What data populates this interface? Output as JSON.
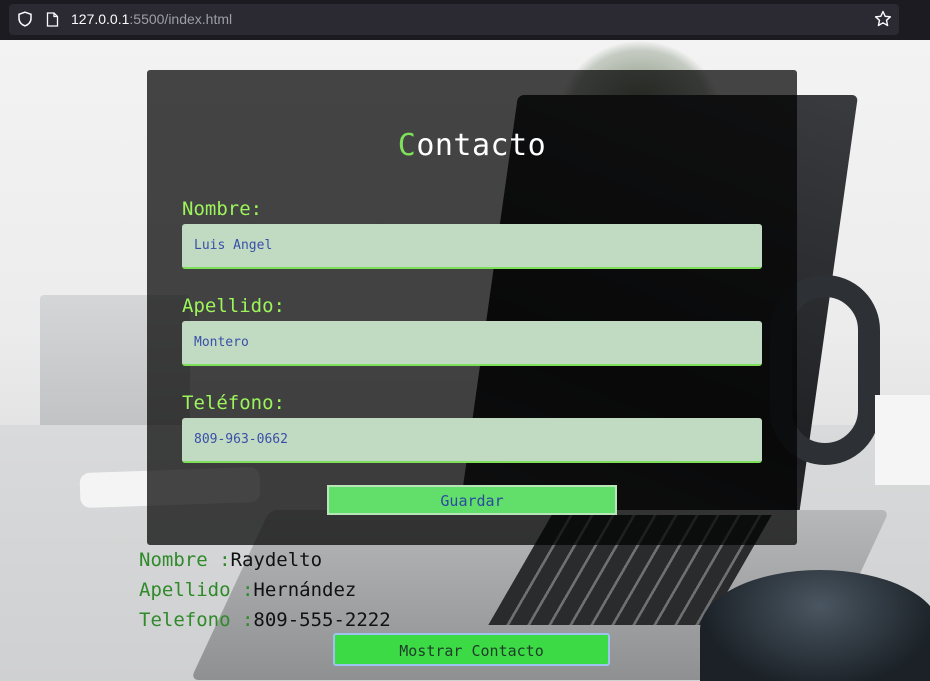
{
  "browser": {
    "url_host": "127.0.0.1",
    "url_rest": ":5500/index.html"
  },
  "form": {
    "title_first": "C",
    "title_rest": "ontacto",
    "nombre_label": "Nombre:",
    "nombre_value": "Luis Angel",
    "apellido_label": "Apellido:",
    "apellido_value": "Montero",
    "telefono_label": "Teléfono:",
    "telefono_value": "809-963-0662",
    "save_label": "Guardar"
  },
  "output": {
    "nombre_key": "Nombre :",
    "nombre_val": "Raydelto",
    "apellido_key": "Apellido :",
    "apellido_val": "Hernández",
    "telefono_key": "Telefono :",
    "telefono_val": "809-555-2222",
    "show_label": "Mostrar Contacto"
  },
  "colors": {
    "accent": "#7ee05a",
    "button": "#62de6b",
    "input_bg": "#c1dbc3"
  }
}
